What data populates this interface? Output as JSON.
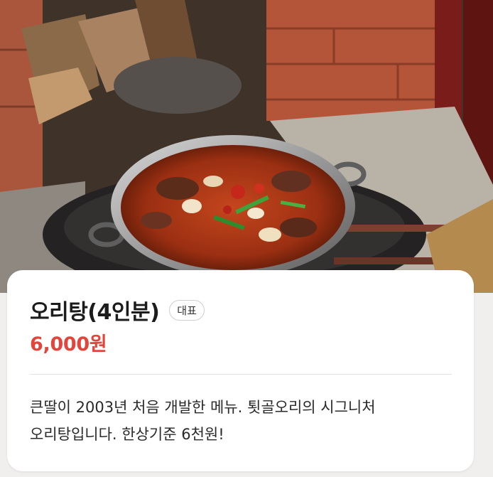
{
  "menu_item": {
    "name": "오리탕(4인분)",
    "badge": "대표",
    "price": "6,000원",
    "description_lines": [
      "큰딸이 2003년 처음 개발한 메뉴. 툇골오리의 시그니처",
      "오리탕입니다. 한상기준 6천원!"
    ]
  },
  "colors": {
    "price": "#e2453c",
    "card_background": "#ffffff",
    "page_background": "#f1efee"
  }
}
